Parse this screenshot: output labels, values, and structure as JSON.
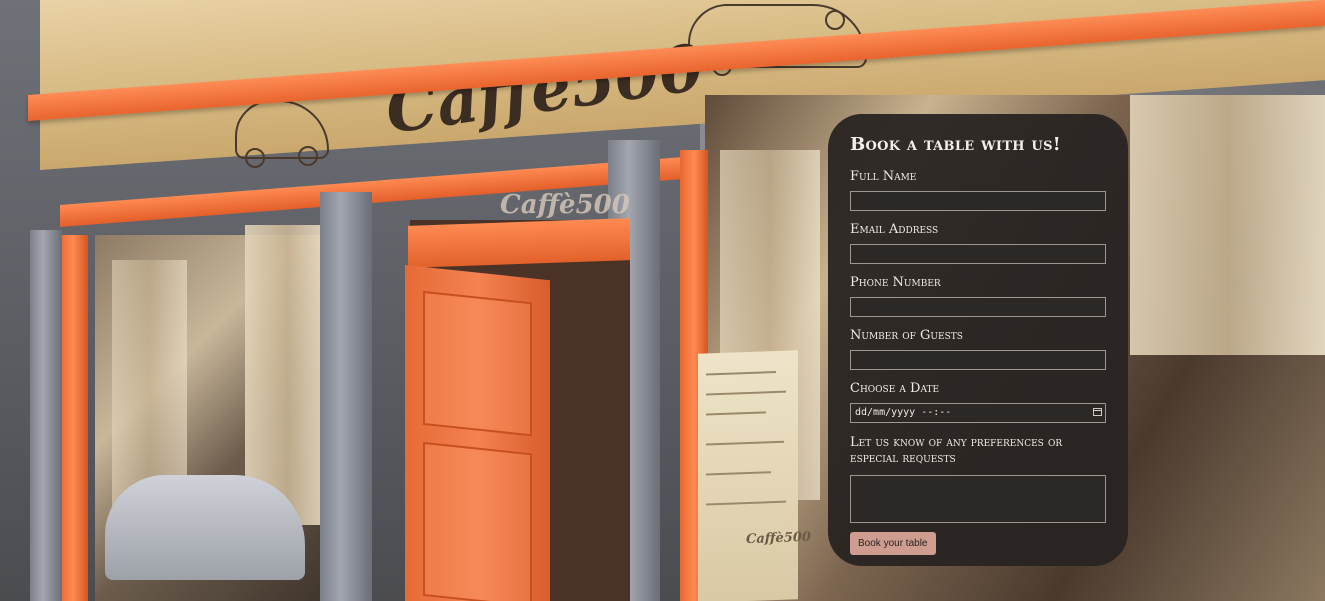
{
  "background": {
    "sign_logo_text": "Caffè500",
    "door_logo_text": "Caffè500",
    "menu_logo_text": "Caffè500"
  },
  "booking_form": {
    "title": "Book a table with us!",
    "fields": {
      "full_name": {
        "label": "Full Name",
        "value": ""
      },
      "email": {
        "label": "Email Address",
        "value": ""
      },
      "phone": {
        "label": "Phone Number",
        "value": ""
      },
      "guests": {
        "label": "Number of Guests",
        "value": ""
      },
      "date": {
        "label": "Choose a Date",
        "placeholder": "dd/mm/yyyy --:--"
      },
      "requests": {
        "label": "Let us know of any preferences or especial requests",
        "value": ""
      }
    },
    "submit_label": "Book your table"
  },
  "colors": {
    "accent_orange": "#f07a45",
    "card_background": "#282422",
    "button": "#cf9d90"
  }
}
